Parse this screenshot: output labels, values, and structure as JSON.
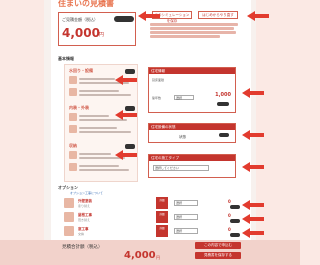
{
  "header": {
    "title": "住まいの見積書"
  },
  "estimate": {
    "label": "ご見積金額（税込）",
    "value": "4,000",
    "unit": "円"
  },
  "buttons": {
    "save": "このシミュレーションを保存",
    "reset": "はじめからやり直す"
  },
  "sections": {
    "basic": "基本情報",
    "options": "オプション"
  },
  "rooms": [
    {
      "name": "水回り・設備"
    },
    {
      "name": "内装・外装"
    },
    {
      "name": "収納"
    }
  ],
  "panels": {
    "p1": {
      "title": "住宅情報",
      "row1": "延床面積",
      "row2": "築年数",
      "select": "選択",
      "value": "1,000"
    },
    "p2": {
      "title": "住宅設備の状態",
      "label": "状態"
    },
    "p3": {
      "title": "住宅の施工タイプ",
      "select": "選択してください"
    }
  },
  "options": {
    "link": "オプション工事について",
    "rows": [
      {
        "name": "外壁塗装",
        "sub": "塗り替え",
        "tag": "詳細",
        "select": "選択",
        "value": "0"
      },
      {
        "name": "屋根工事",
        "sub": "葺き替え",
        "tag": "詳細",
        "select": "選択",
        "value": "0"
      },
      {
        "name": "窓工事",
        "sub": "交換",
        "tag": "詳細",
        "select": "選択",
        "value": "0"
      }
    ]
  },
  "footer": {
    "label": "見積合計額（税込）",
    "value": "4,000",
    "unit": "円",
    "btn1": "この内容で申込む",
    "btn2": "見積書を保存する"
  },
  "colors": {
    "accent": "#c4352e",
    "arrow": "#e23b2e"
  }
}
